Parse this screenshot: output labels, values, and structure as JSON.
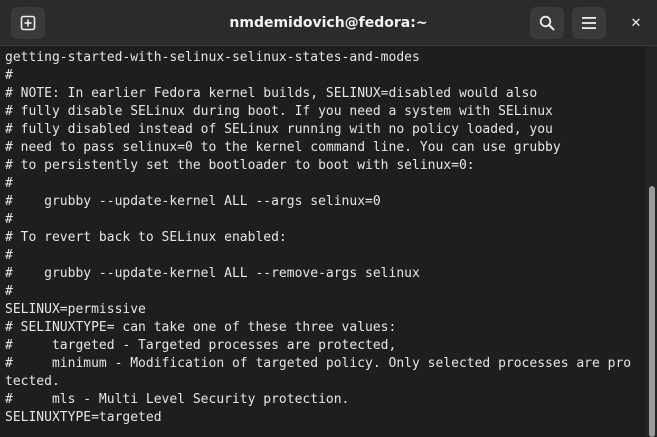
{
  "window": {
    "title": "nmdemidovich@fedora:~"
  },
  "titlebar": {
    "new_tab_icon": "plus-square-icon",
    "search_icon": "search-icon",
    "menu_icon": "hamburger-menu-icon",
    "close_icon": "close-icon",
    "close_glyph": "✕"
  },
  "terminal": {
    "lines": [
      "getting-started-with-selinux-selinux-states-and-modes",
      "#",
      "# NOTE: In earlier Fedora kernel builds, SELINUX=disabled would also",
      "# fully disable SELinux during boot. If you need a system with SELinux",
      "# fully disabled instead of SELinux running with no policy loaded, you",
      "# need to pass selinux=0 to the kernel command line. You can use grubby",
      "# to persistently set the bootloader to boot with selinux=0:",
      "#",
      "#    grubby --update-kernel ALL --args selinux=0",
      "#",
      "# To revert back to SELinux enabled:",
      "#",
      "#    grubby --update-kernel ALL --remove-args selinux",
      "#",
      "SELINUX=permissive",
      "# SELINUXTYPE= can take one of these three values:",
      "#     targeted - Targeted processes are protected,",
      "#     minimum - Modification of targeted policy. Only selected processes are pro",
      "tected.",
      "#     mls - Multi Level Security protection.",
      "SELINUXTYPE=targeted"
    ]
  },
  "colors": {
    "background": "#1e1e1e",
    "titlebar": "#2b2b2b",
    "text": "#e6e6e6"
  }
}
